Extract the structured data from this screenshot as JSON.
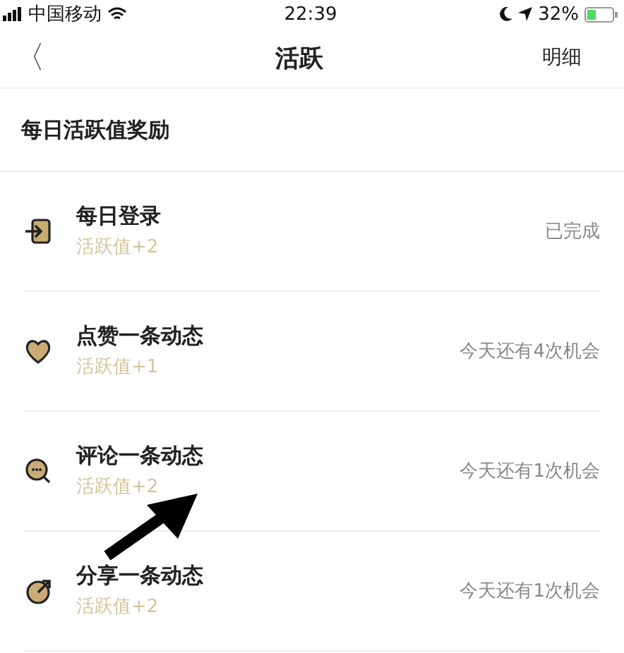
{
  "status_bar": {
    "carrier": "中国移动",
    "time": "22:39",
    "battery": "32%"
  },
  "nav": {
    "back": "〈",
    "title": "活跃",
    "action": "明细"
  },
  "section": {
    "title": "每日活跃值奖励"
  },
  "tasks": [
    {
      "kind": "login",
      "title": "每日登录",
      "reward": "活跃值+2",
      "status": "已完成"
    },
    {
      "kind": "like",
      "title": "点赞一条动态",
      "reward": "活跃值+1",
      "status": "今天还有4次机会"
    },
    {
      "kind": "comment",
      "title": "评论一条动态",
      "reward": "活跃值+2",
      "status": "今天还有1次机会"
    },
    {
      "kind": "share",
      "title": "分享一条动态",
      "reward": "活跃值+2",
      "status": "今天还有1次机会"
    }
  ]
}
